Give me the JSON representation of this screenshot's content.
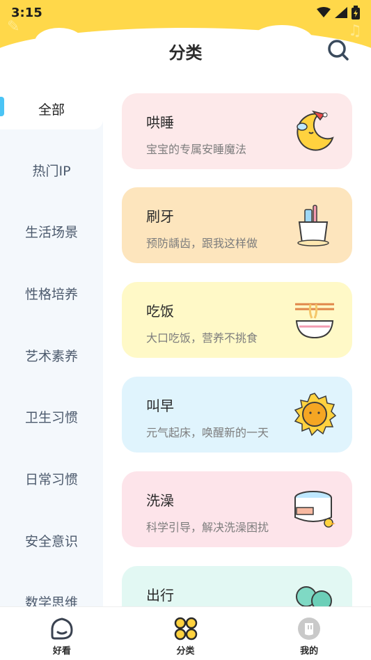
{
  "status_bar": {
    "time": "3:15"
  },
  "header": {
    "title": "分类"
  },
  "sidebar": {
    "items": [
      {
        "label": "全部"
      },
      {
        "label": "热门IP"
      },
      {
        "label": "生活场景"
      },
      {
        "label": "性格培养"
      },
      {
        "label": "艺术素养"
      },
      {
        "label": "卫生习惯"
      },
      {
        "label": "日常习惯"
      },
      {
        "label": "安全意识"
      },
      {
        "label": "数学思维"
      }
    ],
    "active_index": 0,
    "accent_color": "#4bc4f5"
  },
  "cards": [
    {
      "title": "哄睡",
      "subtitle": "宝宝的专属安睡魔法",
      "icon": "sleepy-moon-icon",
      "bg": "#fde9ea"
    },
    {
      "title": "刷牙",
      "subtitle": "预防龋齿，跟我这样做",
      "icon": "toothbrush-cup-icon",
      "bg": "#fde5bd"
    },
    {
      "title": "吃饭",
      "subtitle": "大口吃饭，营养不挑食",
      "icon": "noodle-bowl-icon",
      "bg": "#fff9c7"
    },
    {
      "title": "叫早",
      "subtitle": "元气起床，唤醒新的一天",
      "icon": "sun-icon",
      "bg": "#e0f4fd"
    },
    {
      "title": "洗澡",
      "subtitle": "科学引导，解决洗澡困扰",
      "icon": "bathtub-duck-icon",
      "bg": "#fde4ea"
    },
    {
      "title": "出行",
      "subtitle": "",
      "icon": "tree-icon",
      "bg": "#e2f8f3"
    }
  ],
  "bottom_nav": {
    "items": [
      {
        "label": "好看",
        "icon": "home-icon"
      },
      {
        "label": "分类",
        "icon": "category-grid-icon"
      },
      {
        "label": "我的",
        "icon": "profile-icon"
      }
    ],
    "active_index": 1
  },
  "colors": {
    "header_yellow": "#ffd84a",
    "sidebar_bg": "#f4f8fc"
  }
}
